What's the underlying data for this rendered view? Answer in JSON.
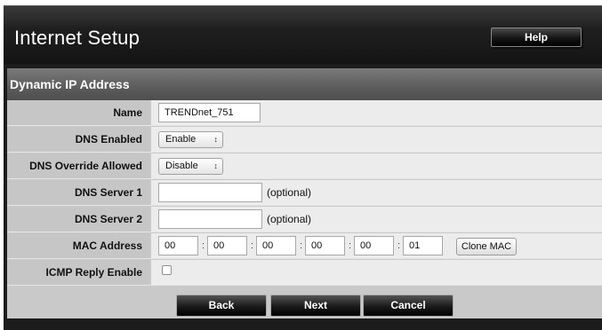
{
  "header": {
    "title": "Internet Setup",
    "help_label": "Help"
  },
  "section": {
    "title": "Dynamic IP Address"
  },
  "form": {
    "name": {
      "label": "Name",
      "value": "TRENDnet_751"
    },
    "dns_enabled": {
      "label": "DNS Enabled",
      "selected": "Enable"
    },
    "dns_override": {
      "label": "DNS Override Allowed",
      "selected": "Disable"
    },
    "dns_server_1": {
      "label": "DNS Server 1",
      "value": "",
      "hint": "(optional)"
    },
    "dns_server_2": {
      "label": "DNS Server 2",
      "value": "",
      "hint": "(optional)"
    },
    "mac_address": {
      "label": "MAC Address",
      "octets": [
        "00",
        "00",
        "00",
        "00",
        "00",
        "01"
      ],
      "separator": ":",
      "clone_label": "Clone MAC"
    },
    "icmp_reply": {
      "label": "ICMP Reply Enable",
      "checked": false
    }
  },
  "buttons": {
    "back": "Back",
    "next": "Next",
    "cancel": "Cancel"
  },
  "icons": {
    "select_arrow": "updown-arrow-icon"
  },
  "colors": {
    "header_bg": "#1c1c1c",
    "section_bg": "#5c5c5c",
    "label_bg": "#c6c6c6",
    "field_bg": "#ececec"
  }
}
